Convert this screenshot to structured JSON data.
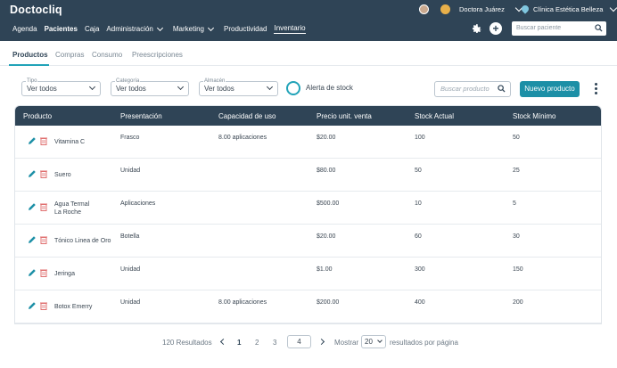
{
  "app": {
    "brand": "Doctocliq"
  },
  "topbar": {
    "user_name": "Doctora Juárez",
    "clinic_name": "Clínica Estética Belleza",
    "search_placeholder": "Buscar paciente"
  },
  "nav": {
    "items": [
      {
        "label": "Agenda"
      },
      {
        "label": "Pacientes"
      },
      {
        "label": "Caja"
      },
      {
        "label": "Administración"
      },
      {
        "label": "Marketing"
      },
      {
        "label": "Productividad"
      },
      {
        "label": "Inventario"
      }
    ]
  },
  "subtabs": [
    "Productos",
    "Compras",
    "Consumo",
    "Preescripciones"
  ],
  "filters": {
    "tipo": {
      "label": "Tipo",
      "value": "Ver todos"
    },
    "categoria": {
      "label": "Categoría",
      "value": "Ver todos"
    },
    "almacen": {
      "label": "Almacén",
      "value": "Ver todos"
    },
    "stock_alert_label": "Alerta de stock",
    "search_placeholder": "Buscar producto",
    "new_button": "Nuevo producto"
  },
  "table": {
    "columns": [
      "Producto",
      "Presentación",
      "Capacidad de uso",
      "Precio unit. venta",
      "Stock Actual",
      "Stock Mínimo"
    ],
    "rows": [
      {
        "producto": "Vitamina C",
        "producto2": "",
        "presentacion": "Frasco",
        "capacidad": "8.00 aplicaciones",
        "precio": "$20.00",
        "stock": "100",
        "minimo": "50"
      },
      {
        "producto": "Suero",
        "producto2": "",
        "presentacion": "Unidad",
        "capacidad": "",
        "precio": "$80.00",
        "stock": "50",
        "minimo": "25"
      },
      {
        "producto": "Agua Termal",
        "producto2": "La Roche",
        "presentacion": "Aplicaciones",
        "capacidad": "",
        "precio": "$500.00",
        "stock": "10",
        "minimo": "5"
      },
      {
        "producto": "Tónico Linea de Oro",
        "producto2": "",
        "presentacion": "Botella",
        "capacidad": "",
        "precio": "$20.00",
        "stock": "60",
        "minimo": "30"
      },
      {
        "producto": "Jeringa",
        "producto2": "",
        "presentacion": "Unidad",
        "capacidad": "",
        "precio": "$1.00",
        "stock": "300",
        "minimo": "150"
      },
      {
        "producto": "Botox Emerry",
        "producto2": "",
        "presentacion": "Unidad",
        "capacidad": "8.00 aplicaciones",
        "precio": "$200.00",
        "stock": "400",
        "minimo": "200"
      }
    ]
  },
  "pagination": {
    "results": "120 Resultados",
    "pages": [
      "1",
      "2",
      "3"
    ],
    "current_input": "4",
    "show_label": "Mostrar",
    "per_page": "20",
    "per_page_suffix": "resultados por página"
  },
  "colors": {
    "header": "#2f4456",
    "accent": "#1c8fa6",
    "delete": "#e07070",
    "edit": "#1c8fa6"
  },
  "icons": [
    "avatar",
    "bell-icon",
    "chevron-down-icon",
    "location-pin-icon",
    "gear-icon",
    "plus-circle-icon",
    "search-icon",
    "pencil-icon",
    "trash-icon",
    "kebab-menu-icon",
    "chevron-left-icon",
    "chevron-right-icon"
  ]
}
